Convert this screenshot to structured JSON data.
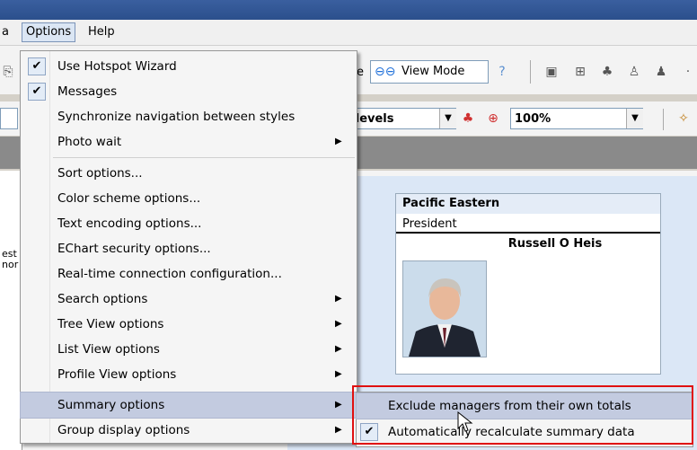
{
  "menubar": {
    "partial": "a",
    "options": "Options",
    "help": "Help"
  },
  "toolbar": {
    "view_mode": "View Mode",
    "partial_mode": "e",
    "levels_combo": "t levels",
    "zoom_combo": "100%"
  },
  "left_partial": {
    "line1": "est",
    "line2": "nor"
  },
  "options_menu": {
    "items": [
      {
        "label": "Use Hotspot Wizard",
        "checked": true
      },
      {
        "label": "Messages",
        "checked": true
      },
      {
        "label": "Synchronize navigation between styles"
      },
      {
        "label": "Photo wait",
        "submenu": true
      },
      {
        "label": "Sort options..."
      },
      {
        "label": "Color scheme options..."
      },
      {
        "label": "Text encoding options..."
      },
      {
        "label": "EChart security options..."
      },
      {
        "label": "Real-time connection configuration..."
      },
      {
        "label": "Search options",
        "submenu": true
      },
      {
        "label": "Tree View options",
        "submenu": true
      },
      {
        "label": "List View options",
        "submenu": true
      },
      {
        "label": "Profile View options",
        "submenu": true
      },
      {
        "label": "Summary options",
        "submenu": true,
        "highlighted": true
      },
      {
        "label": "Group display options",
        "submenu": true
      }
    ]
  },
  "summary_submenu": {
    "items": [
      {
        "label": "Exclude managers from their own totals",
        "checked": false
      },
      {
        "label": "Automatically recalculate summary data",
        "checked": true
      }
    ]
  },
  "card": {
    "org": "Pacific Eastern",
    "title": "President",
    "name": "Russell O Heis"
  },
  "colors": {
    "highlight": "#c3cbe0",
    "annotation": "#e01010",
    "titlebar": "#2b4f8c"
  }
}
